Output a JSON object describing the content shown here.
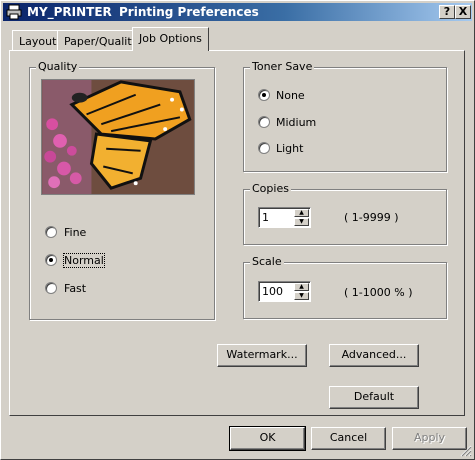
{
  "window": {
    "printer_name": "MY_PRINTER",
    "title": "Printing Preferences",
    "help_button": "?",
    "close_button": "X"
  },
  "tabs": [
    {
      "label": "Layout",
      "active": false
    },
    {
      "label": "Paper/Quality",
      "active": false
    },
    {
      "label": "Job Options",
      "active": true
    }
  ],
  "quality": {
    "label": "Quality",
    "options": [
      {
        "label": "Fine",
        "checked": false
      },
      {
        "label": "Normal",
        "checked": true
      },
      {
        "label": "Fast",
        "checked": false
      }
    ]
  },
  "toner_save": {
    "label": "Toner Save",
    "options": [
      {
        "label": "None",
        "checked": true
      },
      {
        "label": "Midium",
        "checked": false
      },
      {
        "label": "Light",
        "checked": false
      }
    ]
  },
  "copies": {
    "label": "Copies",
    "value": "1",
    "range": "( 1-9999 )"
  },
  "scale": {
    "label": "Scale",
    "value": "100",
    "range": "( 1-1000 % )"
  },
  "buttons": {
    "watermark": "Watermark...",
    "advanced": "Advanced...",
    "default": "Default",
    "ok": "OK",
    "cancel": "Cancel",
    "apply": "Apply"
  },
  "colors": {
    "titlebar_start": "#0a246a",
    "titlebar_end": "#a6caf0",
    "face": "#d4d0c8"
  }
}
